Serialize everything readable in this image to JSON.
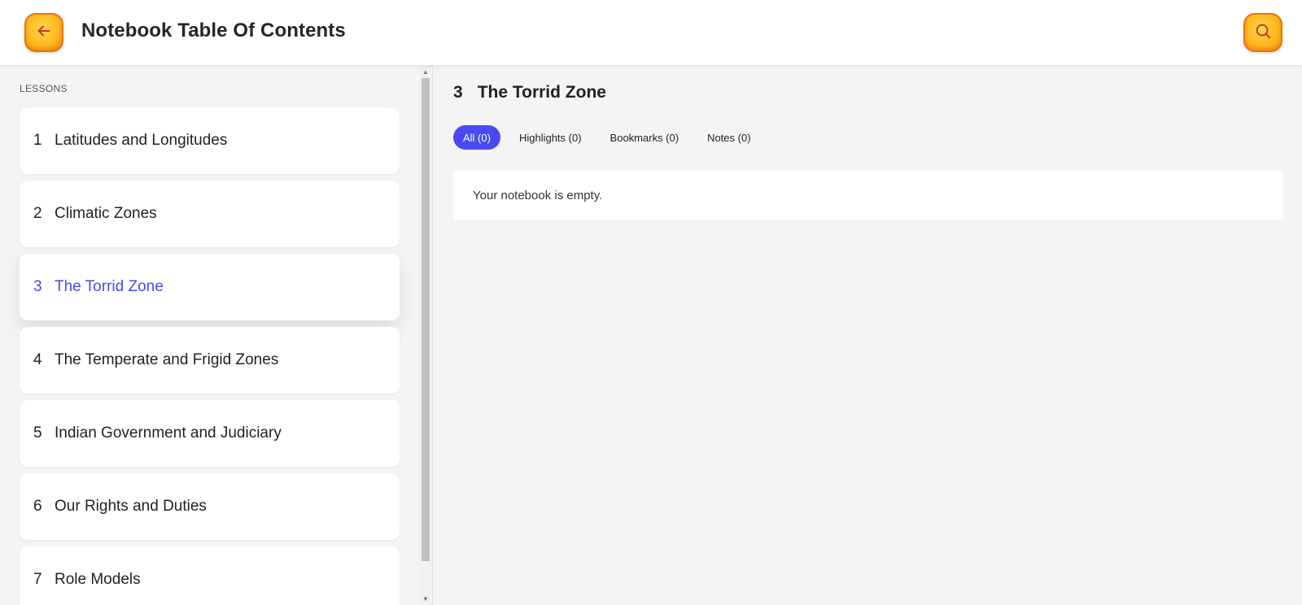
{
  "header": {
    "title": "Notebook Table Of Contents",
    "back_icon": "arrow-left-icon",
    "search_icon": "search-icon",
    "accent": "#ffb820"
  },
  "sidebar": {
    "heading": "LESSONS",
    "lessons": [
      {
        "num": "1",
        "title": "Latitudes and Longitudes"
      },
      {
        "num": "2",
        "title": "Climatic Zones"
      },
      {
        "num": "3",
        "title": "The Torrid Zone"
      },
      {
        "num": "4",
        "title": "The Temperate and Frigid Zones"
      },
      {
        "num": "5",
        "title": "Indian Government and Judiciary"
      },
      {
        "num": "6",
        "title": "Our Rights and Duties"
      },
      {
        "num": "7",
        "title": "Role Models"
      }
    ],
    "active_color": "#4a4ae8"
  },
  "main": {
    "chapter_num": "3",
    "chapter_title": "The Torrid Zone",
    "filters": [
      {
        "label": "All (0)"
      },
      {
        "label": "Highlights (0)"
      },
      {
        "label": "Bookmarks (0)"
      },
      {
        "label": "Notes (0)"
      }
    ],
    "empty_message": "Your notebook is empty."
  }
}
